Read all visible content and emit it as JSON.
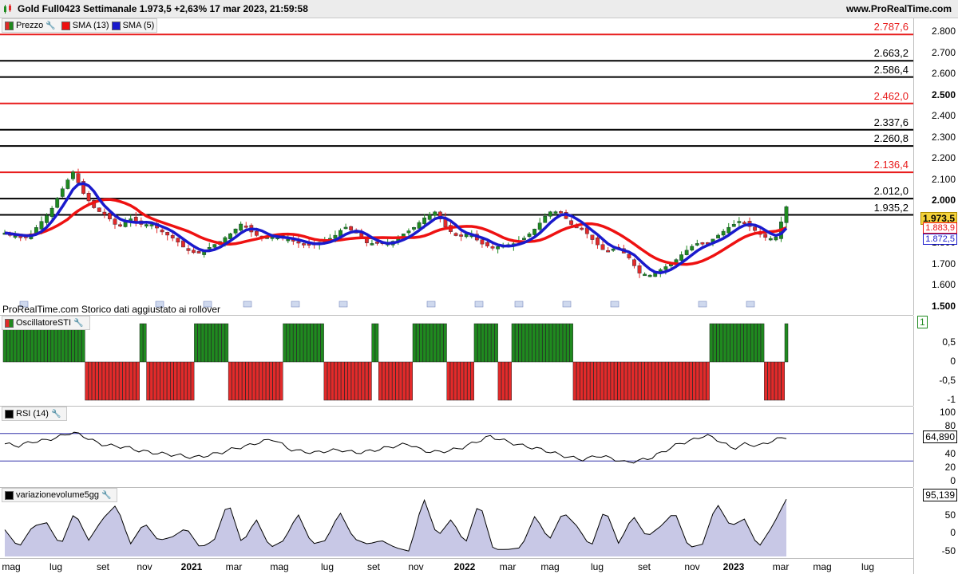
{
  "header": {
    "title": "Gold Full0423 Settimanale 1.973,5 +2,63% 17 mar 2023, 21:59:58",
    "site": "www.ProRealTime.com"
  },
  "colors": {
    "up": "#1f8a1f",
    "down": "#e32a2a",
    "sma13": "#ee1111",
    "sma5": "#1a1acc",
    "resistance": "#e81b1b",
    "level": "#000000"
  },
  "price_panel": {
    "legend": {
      "price": "Prezzo",
      "sma13": "SMA (13)",
      "sma5": "SMA (5)"
    },
    "footnote": "ProRealTime.com  Storico dati aggiustato ai rollover",
    "y_ticks": [
      "2.800",
      "2.700",
      "2.600",
      "2.500",
      "2.400",
      "2.300",
      "2.200",
      "2.100",
      "2.000",
      "1.800",
      "1.700",
      "1.600",
      "1.500"
    ],
    "levels": [
      {
        "label": "2.787,6",
        "value": 2787.6,
        "color": "red"
      },
      {
        "label": "2.663,2",
        "value": 2663.2,
        "color": "black"
      },
      {
        "label": "2.586,4",
        "value": 2586.4,
        "color": "black"
      },
      {
        "label": "2.462,0",
        "value": 2462.0,
        "color": "red"
      },
      {
        "label": "2.337,6",
        "value": 2337.6,
        "color": "black"
      },
      {
        "label": "2.260,8",
        "value": 2260.8,
        "color": "black"
      },
      {
        "label": "2.136,4",
        "value": 2136.4,
        "color": "red"
      },
      {
        "label": "2.012,0",
        "value": 2012.0,
        "color": "black"
      },
      {
        "label": "1.935,2",
        "value": 1935.2,
        "color": "black"
      }
    ],
    "tags": {
      "last": "1.973,5",
      "sma13": "1.883,9",
      "sma5": "1.872,5"
    }
  },
  "sti_panel": {
    "legend": "OscillatoreSTI",
    "y_ticks": [
      "1",
      "0,5",
      "0",
      "-0,5",
      "-1"
    ]
  },
  "rsi_panel": {
    "legend": "RSI (14)",
    "y_ticks": [
      "100",
      "80",
      "60",
      "40",
      "20",
      "0"
    ],
    "last": "64,890"
  },
  "vol_panel": {
    "legend": "variazionevolume5gg",
    "y_ticks": [
      "50",
      "0",
      "-50"
    ],
    "last": "95,139"
  },
  "x_axis": [
    {
      "label": "mag"
    },
    {
      "label": "lug"
    },
    {
      "label": "set"
    },
    {
      "label": "nov"
    },
    {
      "label": "2021",
      "year": true
    },
    {
      "label": "mar"
    },
    {
      "label": "mag"
    },
    {
      "label": "lug"
    },
    {
      "label": "set"
    },
    {
      "label": "nov"
    },
    {
      "label": "2022",
      "year": true
    },
    {
      "label": "mar"
    },
    {
      "label": "mag"
    },
    {
      "label": "lug"
    },
    {
      "label": "set"
    },
    {
      "label": "nov"
    },
    {
      "label": "2023",
      "year": true
    },
    {
      "label": "mar"
    },
    {
      "label": "mag"
    },
    {
      "label": "lug"
    }
  ],
  "chart_data": {
    "type": "candlestick",
    "title": "Gold Full0423 Settimanale",
    "ylim": [
      1500,
      2850
    ],
    "close_anchors": [
      1850,
      1835,
      1825,
      1890,
      1950,
      2050,
      2140,
      2030,
      1960,
      1930,
      1875,
      1920,
      1890,
      1890,
      1850,
      1820,
      1770,
      1750,
      1780,
      1810,
      1850,
      1900,
      1840,
      1830,
      1830,
      1820,
      1800,
      1790,
      1810,
      1830,
      1880,
      1850,
      1800,
      1800,
      1800,
      1840,
      1870,
      1920,
      1950,
      1870,
      1830,
      1850,
      1800,
      1780,
      1790,
      1800,
      1830,
      1880,
      1950,
      1950,
      1890,
      1870,
      1810,
      1760,
      1780,
      1740,
      1660,
      1650,
      1680,
      1710,
      1760,
      1800,
      1800,
      1840,
      1880,
      1910,
      1870,
      1830,
      1820,
      1973.5
    ],
    "sti": [
      1,
      1,
      1,
      1,
      1,
      1,
      1,
      1,
      1,
      1,
      1,
      1,
      1,
      1,
      1,
      1,
      1,
      1,
      1,
      1,
      1,
      1,
      1,
      1,
      -1,
      -1,
      -1,
      -1,
      -1,
      -1,
      -1,
      -1,
      -1,
      -1,
      -1,
      -1,
      -1,
      -1,
      -1,
      -1,
      1,
      1,
      -1,
      -1,
      -1,
      -1,
      -1,
      -1,
      -1,
      -1,
      -1,
      -1,
      -1,
      -1,
      -1,
      -1,
      1,
      1,
      1,
      1,
      1,
      1,
      1,
      1,
      1,
      1,
      -1,
      -1,
      -1,
      -1,
      -1,
      -1,
      -1,
      -1,
      -1,
      -1,
      -1,
      -1,
      -1,
      -1,
      -1,
      -1,
      1,
      1,
      1,
      1,
      1,
      1,
      1,
      1,
      1,
      1,
      1,
      1,
      -1,
      -1,
      -1,
      -1,
      -1,
      -1,
      -1,
      -1,
      -1,
      -1,
      -1,
      -1,
      -1,
      -1,
      1,
      1,
      -1,
      -1,
      -1,
      -1,
      -1,
      -1,
      -1,
      -1,
      -1,
      -1,
      1,
      1,
      1,
      1,
      1,
      1,
      1,
      1,
      1,
      1,
      -1,
      -1,
      -1,
      -1,
      -1,
      -1,
      -1,
      -1,
      1,
      1,
      1,
      1,
      1,
      1,
      1,
      -1,
      -1,
      -1,
      -1,
      1,
      1,
      1,
      1,
      1,
      1,
      1,
      1,
      1,
      1,
      1,
      1,
      1,
      1,
      1,
      1,
      1,
      1,
      -1,
      -1,
      -1,
      -1,
      -1,
      -1,
      -1,
      -1,
      -1,
      -1,
      -1,
      -1,
      -1,
      -1,
      -1,
      -1,
      -1,
      -1,
      -1,
      -1,
      -1,
      -1,
      -1,
      -1,
      -1,
      -1,
      -1,
      -1,
      -1,
      -1,
      -1,
      -1,
      -1,
      -1,
      -1,
      -1,
      -1,
      -1,
      -1,
      -1,
      1,
      1,
      1,
      1,
      1,
      1,
      1,
      1,
      1,
      1,
      1,
      1,
      1,
      1,
      1,
      1,
      -1,
      -1,
      -1,
      -1,
      -1,
      -1,
      1
    ],
    "rsi_anchors": [
      55,
      52,
      58,
      60,
      65,
      72,
      65,
      55,
      52,
      50,
      45,
      42,
      40,
      38,
      35,
      38,
      42,
      48,
      52,
      58,
      62,
      48,
      44,
      42,
      45,
      46,
      42,
      44,
      48,
      52,
      55,
      45,
      43,
      45,
      50,
      58,
      66,
      60,
      54,
      50,
      46,
      40,
      35,
      32,
      38,
      34,
      28,
      30,
      35,
      45,
      55,
      60,
      68,
      60,
      48,
      55,
      52,
      60,
      64.89
    ],
    "vol_anchors": [
      10,
      -40,
      20,
      30,
      -35,
      60,
      -20,
      40,
      80,
      -30,
      30,
      -20,
      -10,
      15,
      -40,
      -20,
      90,
      -30,
      40,
      -40,
      -20,
      55,
      -30,
      -20,
      60,
      -15,
      -30,
      -20,
      -40,
      -50,
      100,
      -10,
      40,
      -30,
      90,
      -45,
      -45,
      -40,
      50,
      -20,
      60,
      20,
      -40,
      70,
      -30,
      50,
      -10,
      20,
      60,
      -40,
      -30,
      85,
      20,
      40,
      -40,
      20,
      95.139
    ]
  }
}
